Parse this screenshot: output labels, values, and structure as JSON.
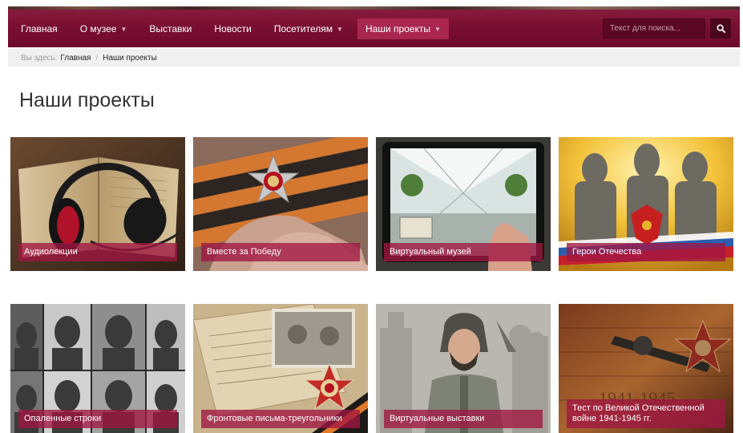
{
  "nav": {
    "items": [
      {
        "label": "Главная",
        "has_dropdown": false,
        "active": false
      },
      {
        "label": "О музее",
        "has_dropdown": true,
        "active": false
      },
      {
        "label": "Выставки",
        "has_dropdown": false,
        "active": false
      },
      {
        "label": "Новости",
        "has_dropdown": false,
        "active": false
      },
      {
        "label": "Посетителям",
        "has_dropdown": true,
        "active": false
      },
      {
        "label": "Наши проекты",
        "has_dropdown": true,
        "active": true
      }
    ],
    "search": {
      "placeholder": "Текст для поиска...",
      "value": "",
      "icon": "search-icon"
    }
  },
  "breadcrumb": {
    "prefix": "Вы здесь:",
    "home": "Главная",
    "separator": "/",
    "current": "Наши проекты"
  },
  "page": {
    "title": "Наши проекты"
  },
  "projects": [
    {
      "label": "Аудиолекции"
    },
    {
      "label": "Вместе за Победу"
    },
    {
      "label": "Виртуальный музей"
    },
    {
      "label": "Герои Отечества"
    },
    {
      "label": "Опаленные строки"
    },
    {
      "label": "Фронтовые письма-треугольники"
    },
    {
      "label": "Виртуальные выставки"
    },
    {
      "label": "Тест по Великой Отечественной войне 1941-1945 гг."
    }
  ],
  "colors": {
    "nav_bg": "#7a0f33",
    "nav_active": "#a8264f",
    "label_bg": "#a01642"
  }
}
